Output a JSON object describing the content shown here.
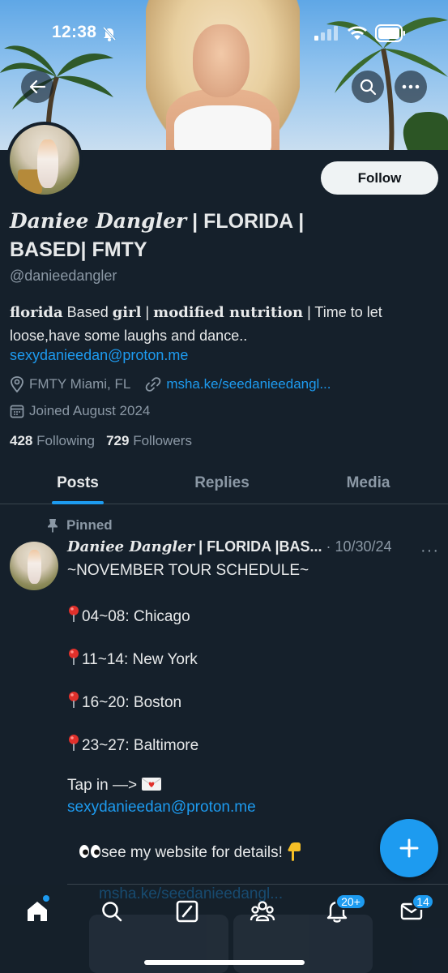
{
  "status_bar": {
    "time": "12:38"
  },
  "profile": {
    "display_name_serif": "Daniee Dangler",
    "display_name_rest": " | FLORIDA | BASED| FMTY",
    "handle": "@danieedangler",
    "follow_label": "Follow",
    "bio": {
      "b1": "florida",
      "t1": " Based ",
      "b2": "girl",
      "t2": " | ",
      "b3": "modified nutrition",
      "t3": " | Time to let loose,have some laughs and dance..",
      "email": "sexydanieedan@proton.me"
    },
    "location": "FMTY Miami, FL",
    "website": "msha.ke/seedanieedangl...",
    "joined": "Joined August 2024",
    "following_count": "428",
    "following_label": "Following",
    "followers_count": "729",
    "followers_label": "Followers"
  },
  "tabs": [
    {
      "label": "Posts"
    },
    {
      "label": "Replies"
    },
    {
      "label": "Media"
    }
  ],
  "post": {
    "pinned_label": "Pinned",
    "author_serif": "Daniee Dangler",
    "author_rest": " | FLORIDA |BAS...",
    "date": " · 10/30/24",
    "more": "···",
    "line1": "~NOVEMBER TOUR SCHEDULE~",
    "stops": [
      "04~08: Chicago",
      "11~14: New York",
      "16~20: Boston",
      "23~27: Baltimore"
    ],
    "tap_in": "Tap in —>",
    "email": "sexydanieedan@proton.me",
    "website_line": "see my website for details!",
    "link_peek": "msha.ke/seedanieedangl..."
  },
  "nav": {
    "notifications_badge": "20+",
    "messages_badge": "14"
  },
  "colors": {
    "background": "#15202b",
    "accent": "#1d9bf0",
    "text_primary": "#e7e9ea",
    "text_secondary": "#8b98a5",
    "border": "#38444d"
  },
  "icons": [
    "back-arrow-icon",
    "search-icon",
    "more-icon",
    "location-icon",
    "link-icon",
    "calendar-icon",
    "pin-icon",
    "compose-icon",
    "home-icon",
    "grok-icon",
    "communities-icon",
    "notifications-icon",
    "messages-icon"
  ]
}
